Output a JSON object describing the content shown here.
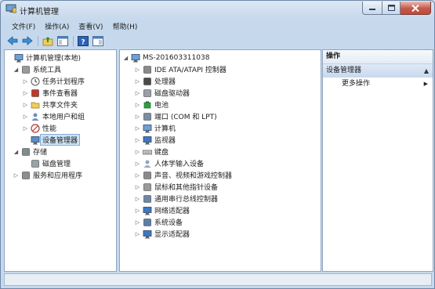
{
  "window": {
    "title": "计算机管理"
  },
  "menu": [
    "文件(F)",
    "操作(A)",
    "查看(V)",
    "帮助(H)"
  ],
  "toolbar": {
    "buttons": [
      "back-icon",
      "forward-icon",
      "up-folder-icon",
      "show-hide-tree-icon",
      "help-icon",
      "console-icon"
    ]
  },
  "left_tree": [
    {
      "label": "计算机管理(本地)",
      "level": 0,
      "expander": "",
      "icon": "computer-management-icon"
    },
    {
      "label": "系统工具",
      "level": 1,
      "expander": "◢",
      "icon": "tools-icon"
    },
    {
      "label": "任务计划程序",
      "level": 2,
      "expander": "▷",
      "icon": "clock-icon"
    },
    {
      "label": "事件查看器",
      "level": 2,
      "expander": "▷",
      "icon": "event-viewer-icon"
    },
    {
      "label": "共享文件夹",
      "level": 2,
      "expander": "▷",
      "icon": "shared-folder-icon"
    },
    {
      "label": "本地用户和组",
      "level": 2,
      "expander": "▷",
      "icon": "users-icon"
    },
    {
      "label": "性能",
      "level": 2,
      "expander": "▷",
      "icon": "performance-icon"
    },
    {
      "label": "设备管理器",
      "level": 2,
      "expander": "",
      "icon": "device-manager-icon",
      "selected": true
    },
    {
      "label": "存储",
      "level": 1,
      "expander": "◢",
      "icon": "storage-icon"
    },
    {
      "label": "磁盘管理",
      "level": 2,
      "expander": "",
      "icon": "disk-management-icon"
    },
    {
      "label": "服务和应用程序",
      "level": 1,
      "expander": "▷",
      "icon": "services-icon"
    }
  ],
  "device_tree": {
    "root": {
      "label": "MS-201603311038",
      "expander": "◢",
      "icon": "computer-icon"
    },
    "items": [
      {
        "label": "IDE ATA/ATAPI 控制器",
        "icon": "ide-controller-icon"
      },
      {
        "label": "处理器",
        "icon": "processor-icon"
      },
      {
        "label": "磁盘驱动器",
        "icon": "disk-drive-icon"
      },
      {
        "label": "电池",
        "icon": "battery-icon"
      },
      {
        "label": "端口 (COM 和 LPT)",
        "icon": "port-icon"
      },
      {
        "label": "计算机",
        "icon": "computer-icon"
      },
      {
        "label": "监视器",
        "icon": "monitor-icon"
      },
      {
        "label": "键盘",
        "icon": "keyboard-icon"
      },
      {
        "label": "人体学输入设备",
        "icon": "hid-icon"
      },
      {
        "label": "声音、视频和游戏控制器",
        "icon": "sound-icon"
      },
      {
        "label": "鼠标和其他指针设备",
        "icon": "mouse-icon"
      },
      {
        "label": "通用串行总线控制器",
        "icon": "usb-icon"
      },
      {
        "label": "网络适配器",
        "icon": "network-adapter-icon"
      },
      {
        "label": "系统设备",
        "icon": "system-device-icon"
      },
      {
        "label": "显示适配器",
        "icon": "display-adapter-icon"
      }
    ]
  },
  "actions": {
    "header": "操作",
    "section": "设备管理器",
    "more": "更多操作"
  }
}
